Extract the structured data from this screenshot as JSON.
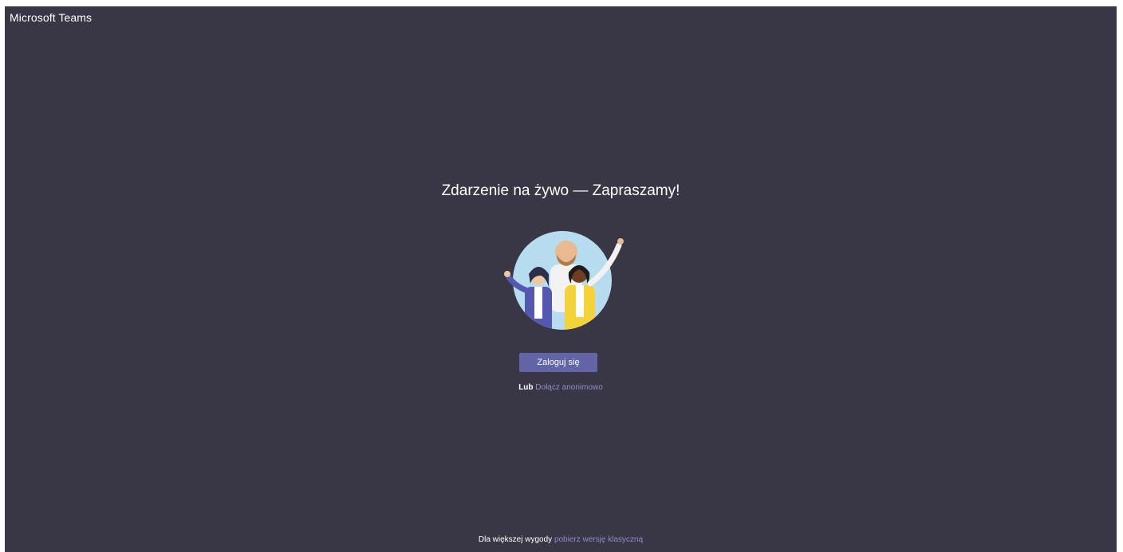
{
  "header": {
    "app_title": "Microsoft Teams"
  },
  "main": {
    "headline": "Zdarzenie na żywo — Zapraszamy!",
    "illustration_icon": "people-waving-illustration",
    "signin_label": "Zaloguj się",
    "or_label": "Lub",
    "anonymous_link": "Dołącz anonimowo"
  },
  "footer": {
    "text": "Dla większej wygody",
    "download_link": "pobierz wersję klasyczną"
  },
  "colors": {
    "background": "#393745",
    "accent": "#6264a7",
    "link": "#8b8cc7"
  }
}
